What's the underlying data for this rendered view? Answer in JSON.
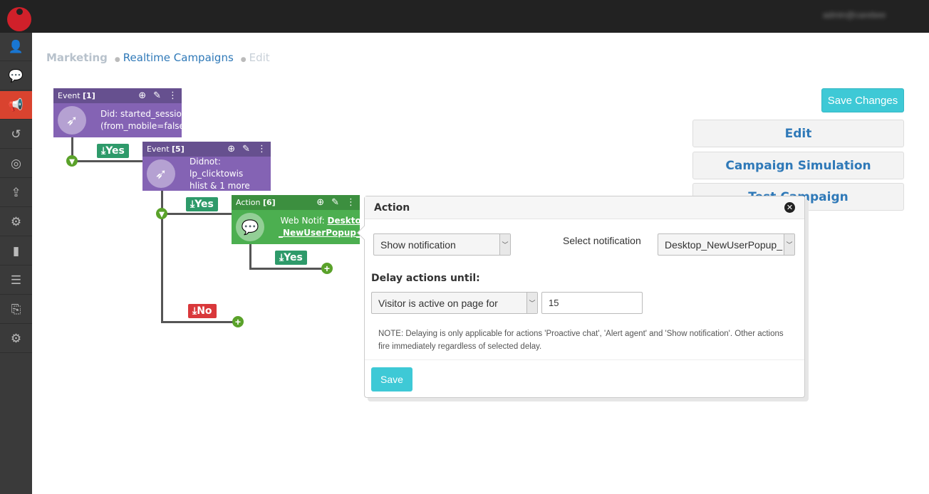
{
  "topbar": {
    "user": "admin@carebee"
  },
  "sidebar": {
    "items": [
      {
        "name": "user",
        "glyph": "👤"
      },
      {
        "name": "chat",
        "glyph": "💬"
      },
      {
        "name": "megaphone",
        "glyph": "📢",
        "active": true
      },
      {
        "name": "history",
        "glyph": "↺"
      },
      {
        "name": "target",
        "glyph": "◎"
      },
      {
        "name": "upload",
        "glyph": "⇪"
      },
      {
        "name": "settings",
        "glyph": "⚙"
      },
      {
        "name": "bar-chart",
        "glyph": "▮"
      },
      {
        "name": "list",
        "glyph": "☰"
      },
      {
        "name": "code-file",
        "glyph": "⎘"
      },
      {
        "name": "settings-2",
        "glyph": "⚙"
      }
    ]
  },
  "breadcrumb": {
    "marketing": "Marketing",
    "realtime": "Realtime Campaigns",
    "edit": "Edit"
  },
  "nodes": {
    "event1": {
      "label": "Event",
      "id": "[1]",
      "line1": "Did: started_session",
      "line2": "(from_mobile=false)"
    },
    "event5": {
      "label": "Event",
      "id": "[5]",
      "line1": "Didnot: lp_clicktowis",
      "line2": "hlist & 1 more"
    },
    "action6": {
      "label": "Action",
      "id": "[6]",
      "prefix": "Web Notif: ",
      "line1": "Desktop",
      "line2": "_NewUserPopup_K"
    }
  },
  "badges": {
    "yes": "Yes",
    "no": "No",
    "arrow": "⤓"
  },
  "right": {
    "save_changes": "Save Changes",
    "edit": "Edit",
    "simulation": "Campaign Simulation",
    "test": "Test Campaign"
  },
  "popup": {
    "title": "Action",
    "action_select": "Show notification",
    "select_notification_label": "Select notification",
    "notification_select": "Desktop_NewUserPopup_",
    "delay_label": "Delay actions until:",
    "delay_select": "Visitor is active on page for",
    "delay_value": "15",
    "note": "NOTE: Delaying is only applicable for actions 'Proactive chat', 'Alert agent' and 'Show notification'. Other actions fire immediately regardless of selected delay.",
    "save": "Save"
  },
  "colors": {
    "event": "#8463b4",
    "action": "#4caf50",
    "yes": "#2e9a6a",
    "no": "#d9383b",
    "accent": "#3ec9d6",
    "active_nav": "#d9432f"
  }
}
